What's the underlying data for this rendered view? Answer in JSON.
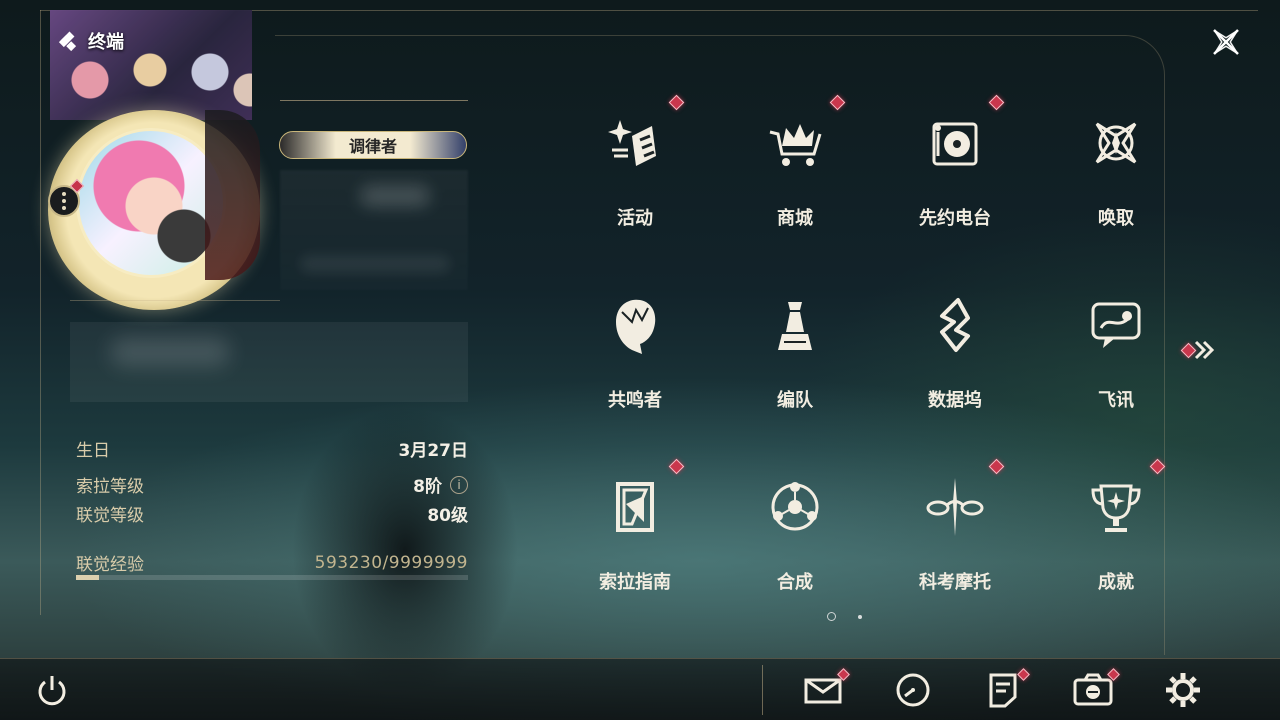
{
  "header": {
    "title": "终端"
  },
  "profile": {
    "rank_badge": "调律者",
    "stats": {
      "birthday_label": "生日",
      "birthday_value": "3月27日",
      "sola_level_label": "索拉等级",
      "sola_level_value": "8阶",
      "union_level_label": "联觉等级",
      "union_level_value": "80级",
      "union_exp_label": "联觉经验",
      "union_exp_value": "593230/9999999",
      "union_exp_progress": 0.059
    }
  },
  "menu": {
    "items": [
      {
        "label": "活动",
        "icon": "sparkle-event-icon",
        "badge": true
      },
      {
        "label": "商城",
        "icon": "crown-cart-icon",
        "badge": true
      },
      {
        "label": "先约电台",
        "icon": "radio-record-icon",
        "badge": true
      },
      {
        "label": "唤取",
        "icon": "compass-star-icon",
        "badge": false
      },
      {
        "label": "共鸣者",
        "icon": "character-head-icon",
        "badge": false
      },
      {
        "label": "编队",
        "icon": "chess-team-icon",
        "badge": false
      },
      {
        "label": "数据坞",
        "icon": "data-dock-icon",
        "badge": false
      },
      {
        "label": "飞讯",
        "icon": "chat-message-icon",
        "badge": false
      },
      {
        "label": "索拉指南",
        "icon": "guide-book-icon",
        "badge": true
      },
      {
        "label": "合成",
        "icon": "synthesis-orbit-icon",
        "badge": false
      },
      {
        "label": "科考摩托",
        "icon": "motorbike-icon",
        "badge": true
      },
      {
        "label": "成就",
        "icon": "trophy-icon",
        "badge": true
      }
    ],
    "page_indicator": {
      "current": 1,
      "total": 2
    }
  },
  "bottom_bar": {
    "icons": [
      "power-icon",
      "mail-icon",
      "clock-icon",
      "notice-icon",
      "camera-icon",
      "settings-gear-icon"
    ]
  },
  "colors": {
    "accent": "#d9ccaa",
    "badge_red": "#c9374d",
    "text_light": "#f2ede1"
  }
}
